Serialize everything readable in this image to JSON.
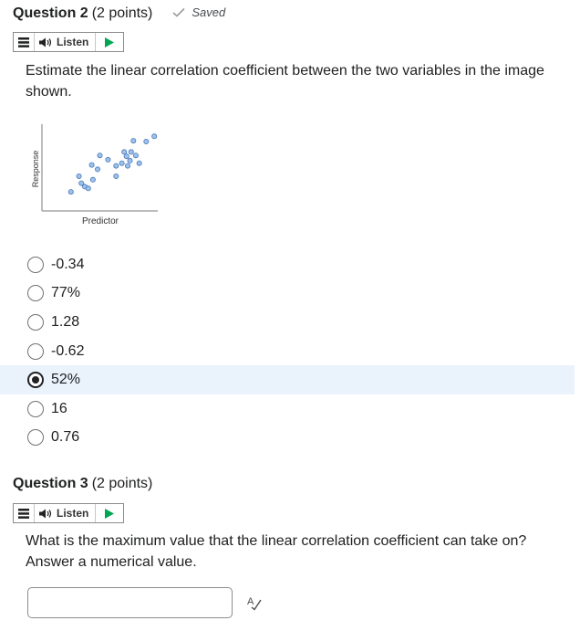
{
  "question2": {
    "title": "Question 2",
    "points": "(2 points)",
    "saved_label": "Saved",
    "listen_label": "Listen",
    "text": "Estimate the linear correlation coefficient between the two variables in the image shown.",
    "chart_data": {
      "type": "scatter",
      "xlabel": "Predictor",
      "ylabel": "Response",
      "xlim": [
        0,
        10
      ],
      "ylim": [
        0,
        10
      ],
      "grid": false,
      "points": [
        {
          "x": 2.5,
          "y": 2.2
        },
        {
          "x": 3.4,
          "y": 3.2
        },
        {
          "x": 3.7,
          "y": 2.8
        },
        {
          "x": 4.0,
          "y": 2.6
        },
        {
          "x": 3.2,
          "y": 4.0
        },
        {
          "x": 4.4,
          "y": 3.6
        },
        {
          "x": 4.3,
          "y": 5.3
        },
        {
          "x": 4.8,
          "y": 4.8
        },
        {
          "x": 5.0,
          "y": 6.4
        },
        {
          "x": 5.7,
          "y": 5.9
        },
        {
          "x": 6.4,
          "y": 4.0
        },
        {
          "x": 6.4,
          "y": 5.2
        },
        {
          "x": 6.9,
          "y": 5.5
        },
        {
          "x": 7.1,
          "y": 6.8
        },
        {
          "x": 7.3,
          "y": 6.3
        },
        {
          "x": 7.4,
          "y": 5.2
        },
        {
          "x": 7.6,
          "y": 5.8
        },
        {
          "x": 7.7,
          "y": 6.8
        },
        {
          "x": 8.1,
          "y": 6.4
        },
        {
          "x": 8.4,
          "y": 5.5
        },
        {
          "x": 7.9,
          "y": 8.1
        },
        {
          "x": 9.0,
          "y": 8.0
        },
        {
          "x": 9.7,
          "y": 8.6
        }
      ]
    },
    "options": [
      {
        "label": "-0.34",
        "selected": false
      },
      {
        "label": "77%",
        "selected": false
      },
      {
        "label": "1.28",
        "selected": false
      },
      {
        "label": "-0.62",
        "selected": false
      },
      {
        "label": "52%",
        "selected": true
      },
      {
        "label": "16",
        "selected": false
      },
      {
        "label": "0.76",
        "selected": false
      }
    ]
  },
  "question3": {
    "title": "Question 3",
    "points": "(2 points)",
    "listen_label": "Listen",
    "text": "What is the maximum value that the linear correlation coefficient can take on? Answer a numerical value.",
    "answer_value": ""
  },
  "colors": {
    "point_fill": "#9ec1ec",
    "point_stroke": "#4a79b8",
    "selected_bg": "#eaf2fb",
    "play_green": "#00a652"
  },
  "icons": {
    "saved": "checkmark-icon",
    "menu": "menu-icon",
    "speaker": "speaker-icon",
    "play": "play-icon",
    "spellcheck": "spellcheck-icon"
  }
}
